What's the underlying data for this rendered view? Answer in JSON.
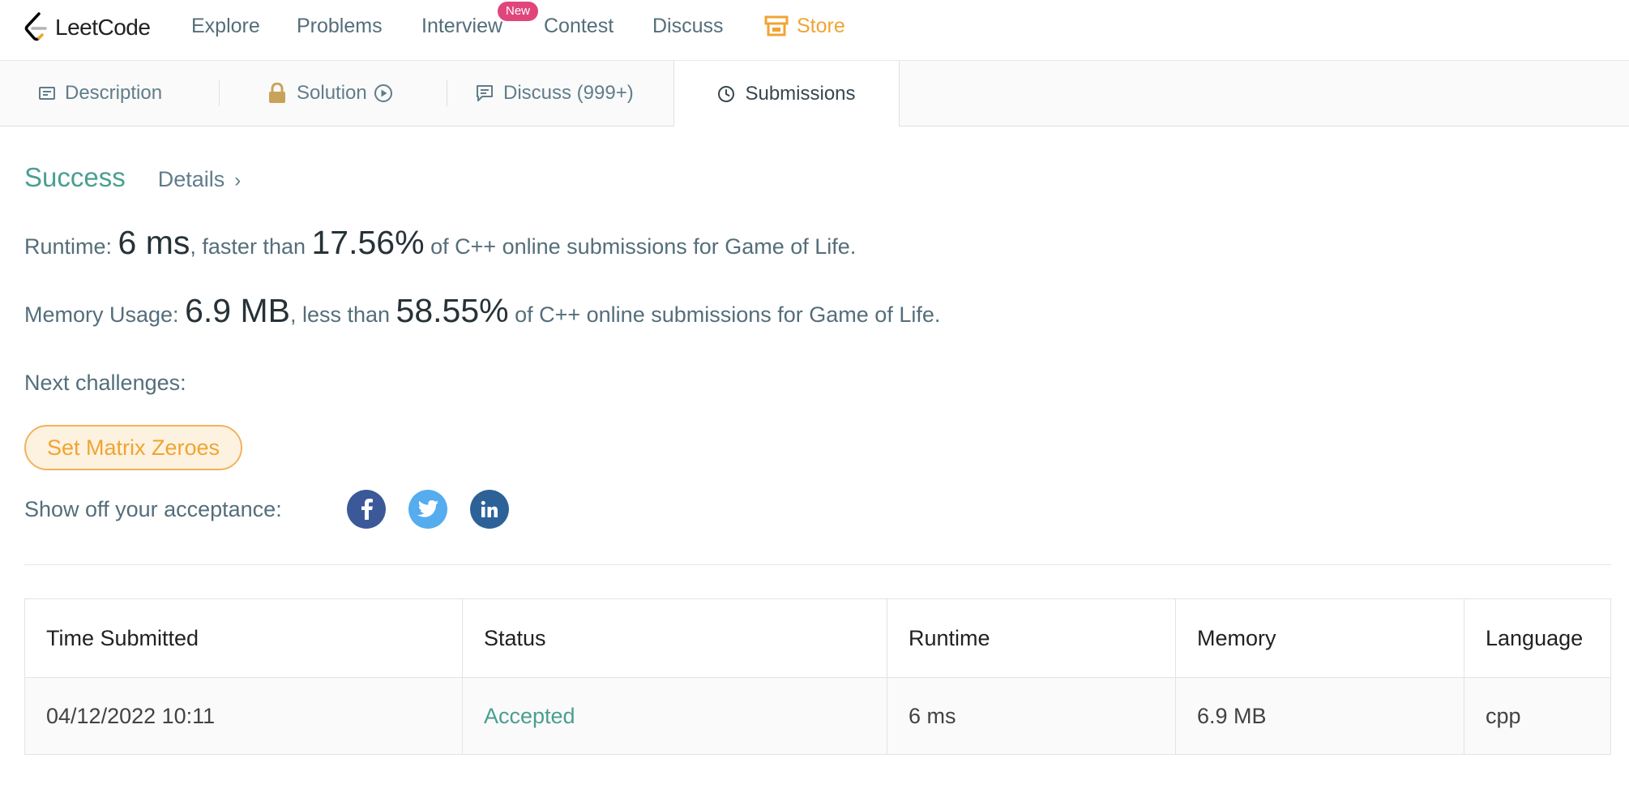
{
  "nav": {
    "logo_text": "LeetCode",
    "items": [
      "Explore",
      "Problems",
      "Interview",
      "Contest",
      "Discuss"
    ],
    "interview_badge": "New",
    "store_label": "Store",
    "store_color": "#f0a431"
  },
  "tabs": {
    "description": "Description",
    "solution": "Solution",
    "discuss": "Discuss (999+)",
    "submissions": "Submissions"
  },
  "result": {
    "status": "Success",
    "details_label": "Details",
    "details_chevron": "›",
    "runtime_prefix": "Runtime: ",
    "runtime_value": "6 ms",
    "runtime_mid": ", faster than ",
    "runtime_percent": "17.56%",
    "runtime_suffix": " of C++ online submissions for Game of Life.",
    "memory_prefix": "Memory Usage: ",
    "memory_value": "6.9 MB",
    "memory_mid": ", less than ",
    "memory_percent": "58.55%",
    "memory_suffix": " of C++ online submissions for Game of Life.",
    "next_label": "Next challenges:",
    "next_challenge": "Set Matrix Zeroes",
    "showoff_label": "Show off your acceptance:",
    "social": [
      "facebook-icon",
      "twitter-icon",
      "linkedin-icon"
    ],
    "success_color": "#4a9f8f"
  },
  "table": {
    "headers": [
      "Time Submitted",
      "Status",
      "Runtime",
      "Memory",
      "Language"
    ],
    "rows": [
      [
        "04/12/2022 10:11",
        "Accepted",
        "6 ms",
        "6.9 MB",
        "cpp"
      ]
    ]
  }
}
